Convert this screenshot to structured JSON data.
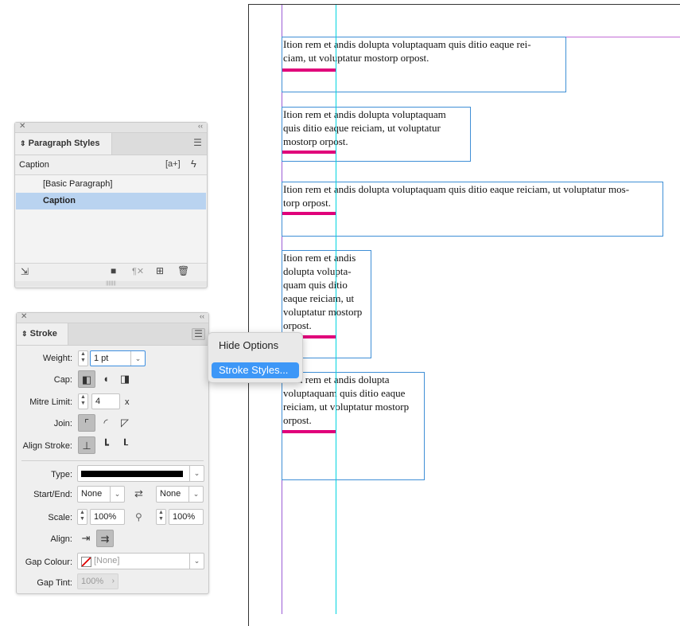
{
  "paragraph_styles": {
    "tab_label": "Paragraph Styles",
    "current_style": "Caption",
    "new_style_glyph": "[a+]",
    "quick_apply_icon": "lightning-icon",
    "items": [
      {
        "label": "[Basic Paragraph]",
        "selected": false
      },
      {
        "label": "Caption",
        "selected": true
      }
    ],
    "footer_icons": [
      "load-styles-icon",
      "new-group-icon",
      "clear-overrides-icon",
      "new-style-icon",
      "delete-icon"
    ]
  },
  "stroke": {
    "tab_label": "Stroke",
    "weight_label": "Weight:",
    "weight_value": "1 pt",
    "cap_label": "Cap:",
    "mitre_label": "Mitre Limit:",
    "mitre_value": "4",
    "mitre_unit": "x",
    "join_label": "Join:",
    "align_stroke_label": "Align Stroke:",
    "type_label": "Type:",
    "start_end_label": "Start/End:",
    "start_value": "None",
    "end_value": "None",
    "scale_label": "Scale:",
    "scale_start": "100%",
    "scale_end": "100%",
    "align_label": "Align:",
    "gap_colour_label": "Gap Colour:",
    "gap_colour_value": "[None]",
    "gap_tint_label": "Gap Tint:",
    "gap_tint_value": "100%"
  },
  "flyout_menu": {
    "items": [
      "Hide Options",
      "Stroke Styles..."
    ],
    "highlighted": "Stroke Styles..."
  },
  "document": {
    "frames": [
      {
        "lines": [
          "Ition rem et andis dolupta voluptaquam quis ditio eaque rei-",
          "ciam, ut voluptatur mostorp orpost."
        ]
      },
      {
        "lines": [
          "Ition rem et andis dolupta voluptaquam",
          "quis ditio eaque reiciam, ut voluptatur",
          "mostorp orpost."
        ]
      },
      {
        "lines": [
          "Ition rem et andis dolupta voluptaquam quis ditio eaque reiciam, ut voluptatur mos-",
          "torp orpost."
        ]
      },
      {
        "lines": [
          "Ition rem et andis",
          "dolupta volupta-",
          "quam quis ditio",
          "eaque reiciam, ut",
          "voluptatur mostorp",
          "orpost."
        ]
      },
      {
        "lines": [
          "Ition rem et andis dolupta",
          "voluptaquam quis ditio eaque",
          "reiciam, ut voluptatur mostorp",
          "orpost."
        ]
      }
    ],
    "rule_color": "#e0007a",
    "frame_color": "#3f8fd6",
    "guide_color": "#00d5e0"
  }
}
